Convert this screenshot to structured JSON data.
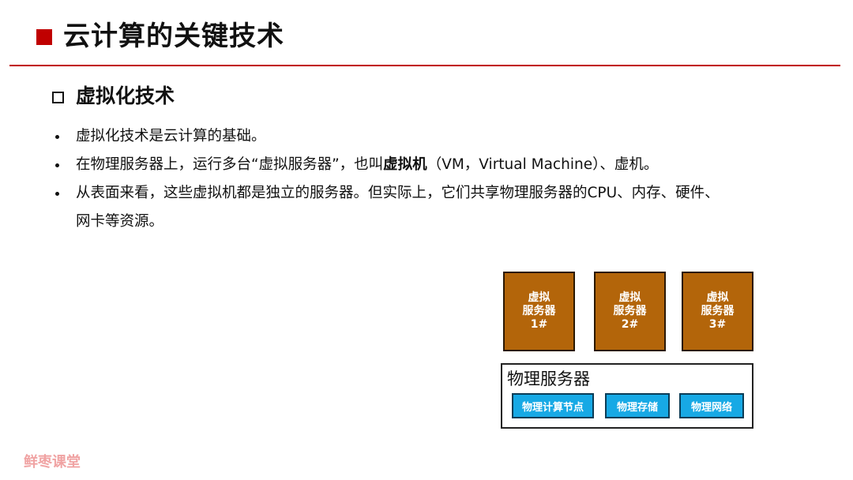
{
  "page": {
    "title": "云计算的关键技术",
    "accent_color": "#c00000"
  },
  "section": {
    "heading": "虚拟化技术",
    "bullets": [
      {
        "parts": [
          "虚拟化技术是云计算的基础。"
        ]
      },
      {
        "parts": [
          "在物理服务器上，运行多台“虚拟服务器”，也叫",
          "虚拟机",
          "（VM，Virtual Machine）、虚机。"
        ]
      },
      {
        "parts": [
          "从表面来看，这些虚拟机都是独立的服务器。但实际上，它们共享物理服务器的CPU、内存、硬件、",
          "网卡等资源。"
        ]
      }
    ]
  },
  "diagram": {
    "vm_color": "#b3650a",
    "module_color": "#17a9e5",
    "vms": [
      {
        "line1": "虚拟",
        "line2": "服务器",
        "line3": "1#"
      },
      {
        "line1": "虚拟",
        "line2": "服务器",
        "line3": "2#"
      },
      {
        "line1": "虚拟",
        "line2": "服务器",
        "line3": "3#"
      }
    ],
    "physical_server": {
      "label": "物理服务器",
      "modules": [
        "物理计算节点",
        "物理存储",
        "物理网络"
      ]
    }
  },
  "watermark": "鲜枣课堂"
}
